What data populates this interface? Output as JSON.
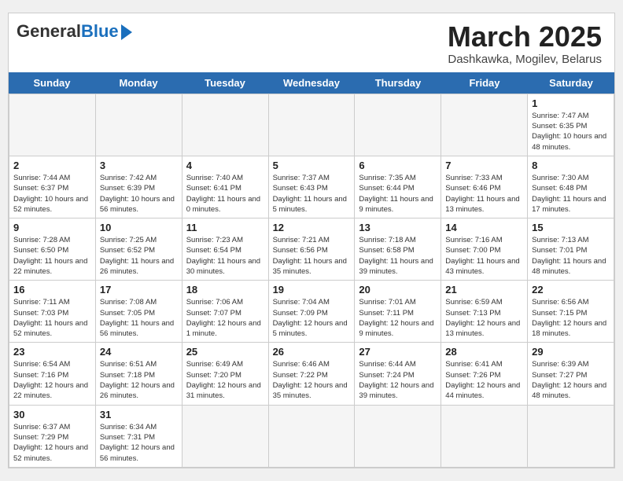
{
  "header": {
    "logo_general": "General",
    "logo_blue": "Blue",
    "month_title": "March 2025",
    "subtitle": "Dashkawka, Mogilev, Belarus"
  },
  "day_headers": [
    "Sunday",
    "Monday",
    "Tuesday",
    "Wednesday",
    "Thursday",
    "Friday",
    "Saturday"
  ],
  "weeks": [
    [
      {
        "date": "",
        "info": ""
      },
      {
        "date": "",
        "info": ""
      },
      {
        "date": "",
        "info": ""
      },
      {
        "date": "",
        "info": ""
      },
      {
        "date": "",
        "info": ""
      },
      {
        "date": "",
        "info": ""
      },
      {
        "date": "1",
        "info": "Sunrise: 7:47 AM\nSunset: 6:35 PM\nDaylight: 10 hours and 48 minutes."
      }
    ],
    [
      {
        "date": "2",
        "info": "Sunrise: 7:44 AM\nSunset: 6:37 PM\nDaylight: 10 hours and 52 minutes."
      },
      {
        "date": "3",
        "info": "Sunrise: 7:42 AM\nSunset: 6:39 PM\nDaylight: 10 hours and 56 minutes."
      },
      {
        "date": "4",
        "info": "Sunrise: 7:40 AM\nSunset: 6:41 PM\nDaylight: 11 hours and 0 minutes."
      },
      {
        "date": "5",
        "info": "Sunrise: 7:37 AM\nSunset: 6:43 PM\nDaylight: 11 hours and 5 minutes."
      },
      {
        "date": "6",
        "info": "Sunrise: 7:35 AM\nSunset: 6:44 PM\nDaylight: 11 hours and 9 minutes."
      },
      {
        "date": "7",
        "info": "Sunrise: 7:33 AM\nSunset: 6:46 PM\nDaylight: 11 hours and 13 minutes."
      },
      {
        "date": "8",
        "info": "Sunrise: 7:30 AM\nSunset: 6:48 PM\nDaylight: 11 hours and 17 minutes."
      }
    ],
    [
      {
        "date": "9",
        "info": "Sunrise: 7:28 AM\nSunset: 6:50 PM\nDaylight: 11 hours and 22 minutes."
      },
      {
        "date": "10",
        "info": "Sunrise: 7:25 AM\nSunset: 6:52 PM\nDaylight: 11 hours and 26 minutes."
      },
      {
        "date": "11",
        "info": "Sunrise: 7:23 AM\nSunset: 6:54 PM\nDaylight: 11 hours and 30 minutes."
      },
      {
        "date": "12",
        "info": "Sunrise: 7:21 AM\nSunset: 6:56 PM\nDaylight: 11 hours and 35 minutes."
      },
      {
        "date": "13",
        "info": "Sunrise: 7:18 AM\nSunset: 6:58 PM\nDaylight: 11 hours and 39 minutes."
      },
      {
        "date": "14",
        "info": "Sunrise: 7:16 AM\nSunset: 7:00 PM\nDaylight: 11 hours and 43 minutes."
      },
      {
        "date": "15",
        "info": "Sunrise: 7:13 AM\nSunset: 7:01 PM\nDaylight: 11 hours and 48 minutes."
      }
    ],
    [
      {
        "date": "16",
        "info": "Sunrise: 7:11 AM\nSunset: 7:03 PM\nDaylight: 11 hours and 52 minutes."
      },
      {
        "date": "17",
        "info": "Sunrise: 7:08 AM\nSunset: 7:05 PM\nDaylight: 11 hours and 56 minutes."
      },
      {
        "date": "18",
        "info": "Sunrise: 7:06 AM\nSunset: 7:07 PM\nDaylight: 12 hours and 1 minute."
      },
      {
        "date": "19",
        "info": "Sunrise: 7:04 AM\nSunset: 7:09 PM\nDaylight: 12 hours and 5 minutes."
      },
      {
        "date": "20",
        "info": "Sunrise: 7:01 AM\nSunset: 7:11 PM\nDaylight: 12 hours and 9 minutes."
      },
      {
        "date": "21",
        "info": "Sunrise: 6:59 AM\nSunset: 7:13 PM\nDaylight: 12 hours and 13 minutes."
      },
      {
        "date": "22",
        "info": "Sunrise: 6:56 AM\nSunset: 7:15 PM\nDaylight: 12 hours and 18 minutes."
      }
    ],
    [
      {
        "date": "23",
        "info": "Sunrise: 6:54 AM\nSunset: 7:16 PM\nDaylight: 12 hours and 22 minutes."
      },
      {
        "date": "24",
        "info": "Sunrise: 6:51 AM\nSunset: 7:18 PM\nDaylight: 12 hours and 26 minutes."
      },
      {
        "date": "25",
        "info": "Sunrise: 6:49 AM\nSunset: 7:20 PM\nDaylight: 12 hours and 31 minutes."
      },
      {
        "date": "26",
        "info": "Sunrise: 6:46 AM\nSunset: 7:22 PM\nDaylight: 12 hours and 35 minutes."
      },
      {
        "date": "27",
        "info": "Sunrise: 6:44 AM\nSunset: 7:24 PM\nDaylight: 12 hours and 39 minutes."
      },
      {
        "date": "28",
        "info": "Sunrise: 6:41 AM\nSunset: 7:26 PM\nDaylight: 12 hours and 44 minutes."
      },
      {
        "date": "29",
        "info": "Sunrise: 6:39 AM\nSunset: 7:27 PM\nDaylight: 12 hours and 48 minutes."
      }
    ],
    [
      {
        "date": "30",
        "info": "Sunrise: 6:37 AM\nSunset: 7:29 PM\nDaylight: 12 hours and 52 minutes."
      },
      {
        "date": "31",
        "info": "Sunrise: 6:34 AM\nSunset: 7:31 PM\nDaylight: 12 hours and 56 minutes."
      },
      {
        "date": "",
        "info": ""
      },
      {
        "date": "",
        "info": ""
      },
      {
        "date": "",
        "info": ""
      },
      {
        "date": "",
        "info": ""
      },
      {
        "date": "",
        "info": ""
      }
    ]
  ]
}
